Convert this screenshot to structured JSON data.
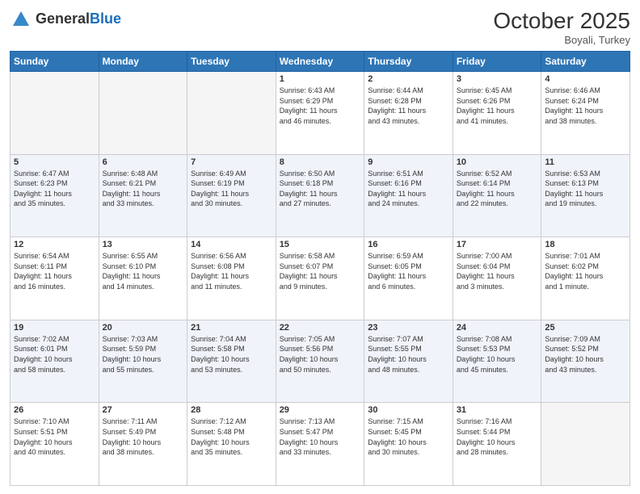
{
  "header": {
    "logo_general": "General",
    "logo_blue": "Blue",
    "month": "October 2025",
    "location": "Boyali, Turkey"
  },
  "weekdays": [
    "Sunday",
    "Monday",
    "Tuesday",
    "Wednesday",
    "Thursday",
    "Friday",
    "Saturday"
  ],
  "weeks": [
    [
      {
        "day": "",
        "info": ""
      },
      {
        "day": "",
        "info": ""
      },
      {
        "day": "",
        "info": ""
      },
      {
        "day": "1",
        "info": "Sunrise: 6:43 AM\nSunset: 6:29 PM\nDaylight: 11 hours\nand 46 minutes."
      },
      {
        "day": "2",
        "info": "Sunrise: 6:44 AM\nSunset: 6:28 PM\nDaylight: 11 hours\nand 43 minutes."
      },
      {
        "day": "3",
        "info": "Sunrise: 6:45 AM\nSunset: 6:26 PM\nDaylight: 11 hours\nand 41 minutes."
      },
      {
        "day": "4",
        "info": "Sunrise: 6:46 AM\nSunset: 6:24 PM\nDaylight: 11 hours\nand 38 minutes."
      }
    ],
    [
      {
        "day": "5",
        "info": "Sunrise: 6:47 AM\nSunset: 6:23 PM\nDaylight: 11 hours\nand 35 minutes."
      },
      {
        "day": "6",
        "info": "Sunrise: 6:48 AM\nSunset: 6:21 PM\nDaylight: 11 hours\nand 33 minutes."
      },
      {
        "day": "7",
        "info": "Sunrise: 6:49 AM\nSunset: 6:19 PM\nDaylight: 11 hours\nand 30 minutes."
      },
      {
        "day": "8",
        "info": "Sunrise: 6:50 AM\nSunset: 6:18 PM\nDaylight: 11 hours\nand 27 minutes."
      },
      {
        "day": "9",
        "info": "Sunrise: 6:51 AM\nSunset: 6:16 PM\nDaylight: 11 hours\nand 24 minutes."
      },
      {
        "day": "10",
        "info": "Sunrise: 6:52 AM\nSunset: 6:14 PM\nDaylight: 11 hours\nand 22 minutes."
      },
      {
        "day": "11",
        "info": "Sunrise: 6:53 AM\nSunset: 6:13 PM\nDaylight: 11 hours\nand 19 minutes."
      }
    ],
    [
      {
        "day": "12",
        "info": "Sunrise: 6:54 AM\nSunset: 6:11 PM\nDaylight: 11 hours\nand 16 minutes."
      },
      {
        "day": "13",
        "info": "Sunrise: 6:55 AM\nSunset: 6:10 PM\nDaylight: 11 hours\nand 14 minutes."
      },
      {
        "day": "14",
        "info": "Sunrise: 6:56 AM\nSunset: 6:08 PM\nDaylight: 11 hours\nand 11 minutes."
      },
      {
        "day": "15",
        "info": "Sunrise: 6:58 AM\nSunset: 6:07 PM\nDaylight: 11 hours\nand 9 minutes."
      },
      {
        "day": "16",
        "info": "Sunrise: 6:59 AM\nSunset: 6:05 PM\nDaylight: 11 hours\nand 6 minutes."
      },
      {
        "day": "17",
        "info": "Sunrise: 7:00 AM\nSunset: 6:04 PM\nDaylight: 11 hours\nand 3 minutes."
      },
      {
        "day": "18",
        "info": "Sunrise: 7:01 AM\nSunset: 6:02 PM\nDaylight: 11 hours\nand 1 minute."
      }
    ],
    [
      {
        "day": "19",
        "info": "Sunrise: 7:02 AM\nSunset: 6:01 PM\nDaylight: 10 hours\nand 58 minutes."
      },
      {
        "day": "20",
        "info": "Sunrise: 7:03 AM\nSunset: 5:59 PM\nDaylight: 10 hours\nand 55 minutes."
      },
      {
        "day": "21",
        "info": "Sunrise: 7:04 AM\nSunset: 5:58 PM\nDaylight: 10 hours\nand 53 minutes."
      },
      {
        "day": "22",
        "info": "Sunrise: 7:05 AM\nSunset: 5:56 PM\nDaylight: 10 hours\nand 50 minutes."
      },
      {
        "day": "23",
        "info": "Sunrise: 7:07 AM\nSunset: 5:55 PM\nDaylight: 10 hours\nand 48 minutes."
      },
      {
        "day": "24",
        "info": "Sunrise: 7:08 AM\nSunset: 5:53 PM\nDaylight: 10 hours\nand 45 minutes."
      },
      {
        "day": "25",
        "info": "Sunrise: 7:09 AM\nSunset: 5:52 PM\nDaylight: 10 hours\nand 43 minutes."
      }
    ],
    [
      {
        "day": "26",
        "info": "Sunrise: 7:10 AM\nSunset: 5:51 PM\nDaylight: 10 hours\nand 40 minutes."
      },
      {
        "day": "27",
        "info": "Sunrise: 7:11 AM\nSunset: 5:49 PM\nDaylight: 10 hours\nand 38 minutes."
      },
      {
        "day": "28",
        "info": "Sunrise: 7:12 AM\nSunset: 5:48 PM\nDaylight: 10 hours\nand 35 minutes."
      },
      {
        "day": "29",
        "info": "Sunrise: 7:13 AM\nSunset: 5:47 PM\nDaylight: 10 hours\nand 33 minutes."
      },
      {
        "day": "30",
        "info": "Sunrise: 7:15 AM\nSunset: 5:45 PM\nDaylight: 10 hours\nand 30 minutes."
      },
      {
        "day": "31",
        "info": "Sunrise: 7:16 AM\nSunset: 5:44 PM\nDaylight: 10 hours\nand 28 minutes."
      },
      {
        "day": "",
        "info": ""
      }
    ]
  ]
}
